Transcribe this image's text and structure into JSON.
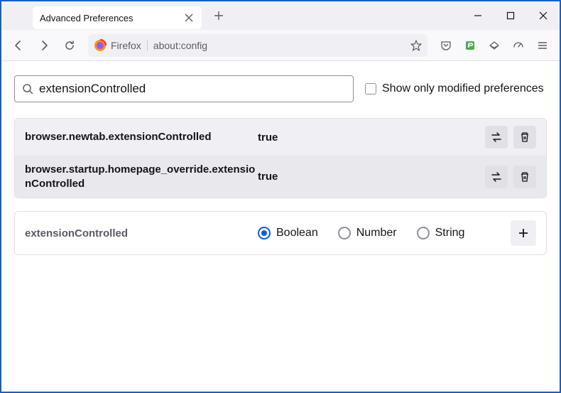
{
  "window": {
    "tab_title": "Advanced Preferences"
  },
  "nav": {
    "identity": "Firefox",
    "url": "about:config"
  },
  "search": {
    "value": "extensionControlled",
    "checkbox_label": "Show only modified preferences"
  },
  "prefs": [
    {
      "name": "browser.newtab.extensionControlled",
      "value": "true"
    },
    {
      "name": "browser.startup.homepage_override.extensionControlled",
      "value": "true"
    }
  ],
  "add": {
    "name": "extensionControlled",
    "types": [
      "Boolean",
      "Number",
      "String"
    ],
    "selected": "Boolean"
  }
}
